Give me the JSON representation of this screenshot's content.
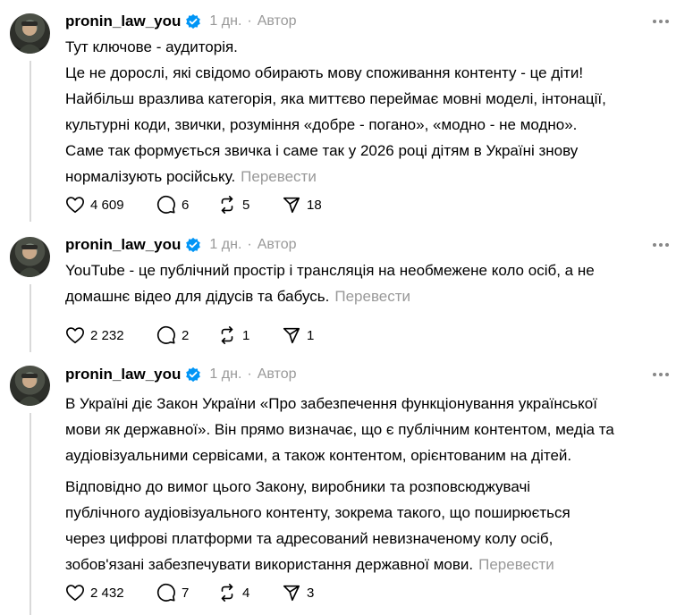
{
  "posts": [
    {
      "username": "pronin_law_you",
      "time": "1 дн.",
      "separator": "·",
      "author_label": "Автор",
      "paragraphs": [
        "Тут ключове - аудиторія.",
        "Це не дорослі, які свідомо обирають мову споживання контенту - це діти!",
        "Найбільш вразлива категорія, яка миттєво переймає мовні моделі, інтонації,",
        "культурні коди, звички, розуміння «добре - погано», «модно - не модно».",
        "Саме так формується звичка і саме так у 2026 році дітям в Україні знову",
        "нормалізують російську."
      ],
      "translate": "Перевести",
      "likes": "4 609",
      "comments": "6",
      "reposts": "5",
      "shares": "18"
    },
    {
      "username": "pronin_law_you",
      "time": "1 дн.",
      "separator": "·",
      "author_label": "Автор",
      "paragraphs": [
        "YouTube - це публічний простір і трансляція на необмежене коло осіб, а не",
        "домашнє відео для дідусів та бабусь."
      ],
      "translate": "Перевести",
      "likes": "2 232",
      "comments": "2",
      "reposts": "1",
      "shares": "1"
    },
    {
      "username": "pronin_law_you",
      "time": "1 дн.",
      "separator": "·",
      "author_label": "Автор",
      "paragraphs": [
        "В Україні діє Закон України «Про забезпечення функціонування української",
        "мови як державної». Він прямо визначає, що є публічним контентом, медіа та",
        "аудіовізуальними сервісами, а також контентом, орієнтованим на дітей."
      ],
      "paragraphs2": [
        "Відповідно до вимог цього Закону, виробники та розповсюджувачі",
        "публічного аудіовізуального контенту, зокрема такого, що поширюється",
        "через цифрові платформи та адресований невизначеному колу осіб,",
        "зобов'язані забезпечувати використання державної мови."
      ],
      "translate": "Перевести",
      "likes": "2 432",
      "comments": "7",
      "reposts": "4",
      "shares": "3"
    }
  ]
}
